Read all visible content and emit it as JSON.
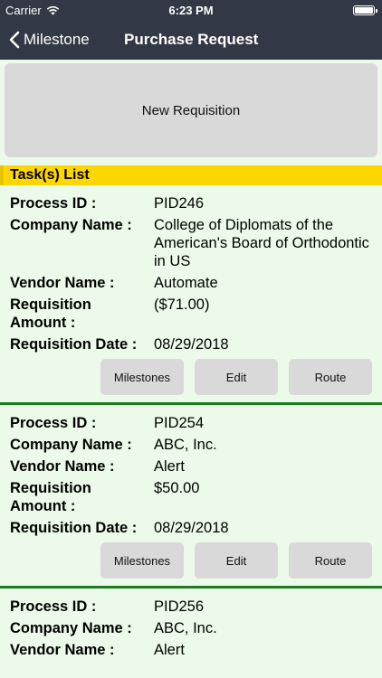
{
  "status": {
    "carrier": "Carrier",
    "time": "6:23 PM"
  },
  "nav": {
    "back_label": "Milestone",
    "title": "Purchase Request"
  },
  "new_requisition_label": "New Requisition",
  "section_title": "Task(s) List",
  "labels": {
    "process_id": "Process ID :",
    "company_name": "Company Name :",
    "vendor_name": "Vendor Name :",
    "requisition_amount": "Requisition Amount :",
    "requisition_date": "Requisition Date :"
  },
  "buttons": {
    "milestones": "Milestones",
    "edit": "Edit",
    "route": "Route"
  },
  "tasks": [
    {
      "process_id": "PID246",
      "company_name": "College of Diplomats of the American's Board of Orthodontic in US",
      "vendor_name": "Automate",
      "requisition_amount": "($71.00)",
      "requisition_date": "08/29/2018"
    },
    {
      "process_id": "PID254",
      "company_name": "ABC, Inc.",
      "vendor_name": "Alert",
      "requisition_amount": "$50.00",
      "requisition_date": "08/29/2018"
    },
    {
      "process_id": "PID256",
      "company_name": "ABC, Inc.",
      "vendor_name": "Alert"
    }
  ]
}
